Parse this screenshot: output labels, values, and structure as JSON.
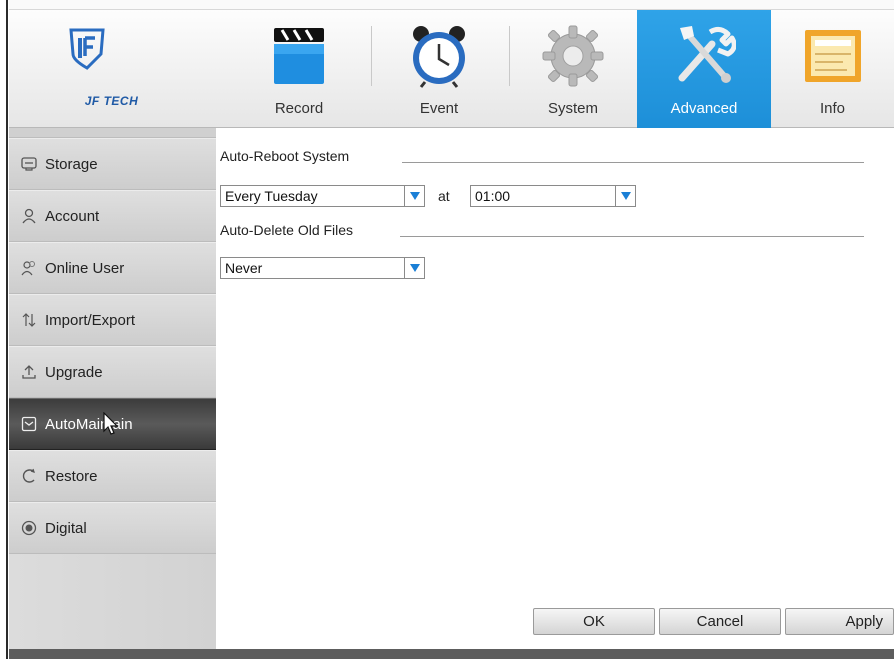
{
  "brand": {
    "logo_text": "JF TECH"
  },
  "nav": {
    "tabs": [
      {
        "label": "Record",
        "icon": "record-icon",
        "active": false
      },
      {
        "label": "Event",
        "icon": "clock-icon",
        "active": false
      },
      {
        "label": "System",
        "icon": "gear-icon",
        "active": false
      },
      {
        "label": "Advanced",
        "icon": "tools-icon",
        "active": true
      },
      {
        "label": "Info",
        "icon": "info-panel-icon",
        "active": false
      }
    ]
  },
  "sidebar": {
    "items": [
      {
        "label": "Storage",
        "icon": "storage-icon",
        "active": false
      },
      {
        "label": "Account",
        "icon": "account-icon",
        "active": false
      },
      {
        "label": "Online User",
        "icon": "online-user-icon",
        "active": false
      },
      {
        "label": "Import/Export",
        "icon": "import-export-icon",
        "active": false
      },
      {
        "label": "Upgrade",
        "icon": "upgrade-icon",
        "active": false
      },
      {
        "label": "AutoMaintain",
        "icon": "auto-maintain-icon",
        "active": true
      },
      {
        "label": "Restore",
        "icon": "restore-icon",
        "active": false
      },
      {
        "label": "Digital",
        "icon": "digital-icon",
        "active": false
      }
    ]
  },
  "main": {
    "reboot": {
      "title": "Auto-Reboot System",
      "day_value": "Every Tuesday",
      "at_label": "at",
      "time_value": "01:00"
    },
    "delete_files": {
      "title": "Auto-Delete Old Files",
      "value": "Never"
    },
    "buttons": {
      "ok": "OK",
      "cancel": "Cancel",
      "apply": "Apply"
    }
  },
  "colors": {
    "accent": "#1d8fd8",
    "active_sidebar": "#3c3c3c",
    "dropdown_arrow": "#1a7fd6"
  }
}
